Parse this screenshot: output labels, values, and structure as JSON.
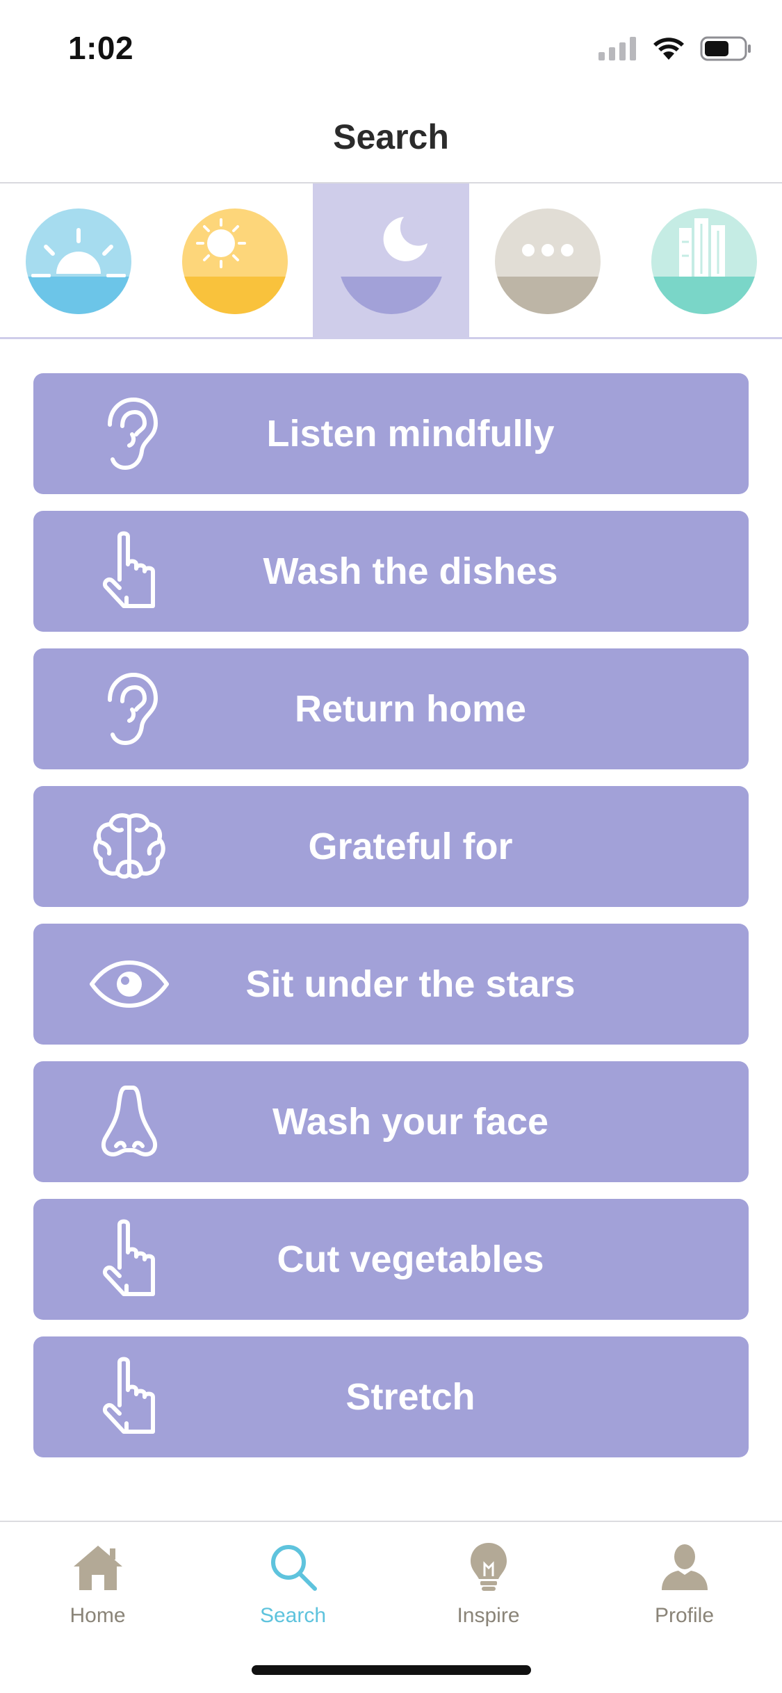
{
  "status_bar": {
    "time": "1:02"
  },
  "header": {
    "title": "Search"
  },
  "categories": [
    {
      "name": "sunrise",
      "icon": "sunrise-icon",
      "colors": {
        "top": "#a6dcef",
        "bottom": "#6cc5e8"
      }
    },
    {
      "name": "day",
      "icon": "sun-icon",
      "colors": {
        "top": "#fdd67a",
        "bottom": "#f9c23c"
      }
    },
    {
      "name": "night",
      "icon": "moon-icon",
      "selected": true,
      "colors": {
        "top": "#cfcdea",
        "bottom": "#a2a1d8"
      }
    },
    {
      "name": "anytime",
      "icon": "ellipsis-icon",
      "colors": {
        "top": "#e1ddd5",
        "bottom": "#bdb5a6"
      }
    },
    {
      "name": "work",
      "icon": "building-icon",
      "colors": {
        "top": "#c5ece4",
        "bottom": "#7ad6c8"
      }
    }
  ],
  "activities": [
    {
      "label": "Listen mindfully",
      "icon": "ear-icon"
    },
    {
      "label": "Wash the dishes",
      "icon": "hand-pointer-icon"
    },
    {
      "label": "Return home",
      "icon": "ear-icon"
    },
    {
      "label": "Grateful for",
      "icon": "brain-icon"
    },
    {
      "label": "Sit under the stars",
      "icon": "eye-icon"
    },
    {
      "label": "Wash your face",
      "icon": "nose-icon"
    },
    {
      "label": "Cut vegetables",
      "icon": "hand-pointer-icon"
    },
    {
      "label": "Stretch",
      "icon": "hand-pointer-icon"
    }
  ],
  "tab_bar": {
    "tabs": [
      {
        "label": "Home",
        "icon": "home-icon"
      },
      {
        "label": "Search",
        "icon": "search-icon",
        "active": true
      },
      {
        "label": "Inspire",
        "icon": "lightbulb-icon"
      },
      {
        "label": "Profile",
        "icon": "person-icon"
      }
    ]
  },
  "theme": {
    "accent": "#5ec3dd",
    "activity_bg": "#a2a1d8",
    "selected_bg": "#cfcdea",
    "tab_inactive": "#8a8478"
  }
}
